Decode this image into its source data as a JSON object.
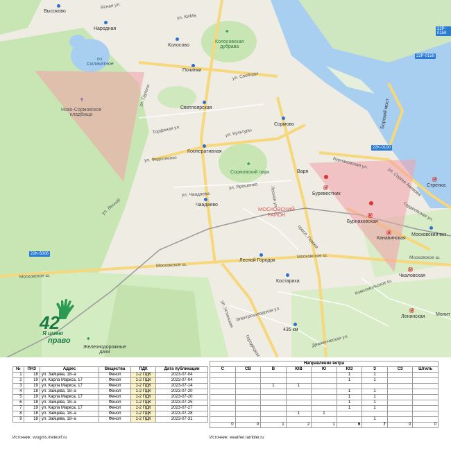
{
  "map": {
    "labels": {
      "vysokovo": "Высоково",
      "narodnaya": "Народная",
      "kolosovo": "Колосово",
      "kolosovskaya": "Колосовская\nдубрава",
      "silikatnoe": "оз.\nСиликатное",
      "pochinki": "Починки",
      "cemetery": "Ново-Сормовское\nкладбище",
      "svetloyarskaya": "Светлоярская",
      "sormovo": "Сормово",
      "kooperativnaya": "Кооперативная",
      "sormovsky_park": "Сормовский парк",
      "chaadaevo": "Чаадаево",
      "moskovsky_rayon": "МОСКОВСКИЙ\nРАЙОН",
      "lesnoy_gorodok": "Лесной Городок",
      "kostariha": "Костариха",
      "burevestnik": "Буревестник",
      "burnakovskaya": "Бурнаковская",
      "kanavinskaya": "Канавинская",
      "moskovsky_vkz": "Московский вкз.",
      "strelka": "Стрелка",
      "chkalovskaya": "Чкаловская",
      "leninskaya": "Ленинская",
      "molit": "Молит",
      "varya": "Варя",
      "zhd_dachi": "Железнодорожные\nдачи",
      "km435": "435 км",
      "borsky_most": "Борский мост"
    },
    "streets": {
      "kima": "ул. КИМа",
      "yasnaya": "Ясная ул.",
      "svobody": "ул. Свободы",
      "gaugelya": "ул. Гаугеля",
      "torfyanaya": "Торфяная ул.",
      "kultury": "ул. Культуры",
      "fedoseenko": "ул. Федосеенко",
      "yaroshenko": "ул. Ярошенко",
      "chaadaeva": "ул. Чаадаева",
      "moskovskoe1": "Московское ш.",
      "moskovskoe2": "Московское ш.",
      "moskovskoe3": "Московское ш.",
      "moskovskoe4": "Московское ш.",
      "geroev": "просп. Героев",
      "burnakovskaya_st": "Бурнаковская ул.",
      "sergeya_akimova": "ул. Сергея Акимова",
      "gordeevskaya": "Гордеевская ул.",
      "konsomolskaya": "Комсомольское ш.",
      "elektrozavodskaya": "Электрозаводская ул.",
      "gorodetskaya": "Городецкая ул.",
      "dvigatel": "Движенческая ул.",
      "lesnoy": "ул. Лесной",
      "ustinskaya": "ул. Устинская",
      "lesnaya": "Лесная ул."
    },
    "shields": {
      "r1": "22P-0159",
      "r2": "22P-0159",
      "r3": "22K-0100",
      "r4": "22K-5006"
    },
    "logo": {
      "number": "42",
      "line1": "Я имею",
      "line2": "право"
    }
  },
  "table_left": {
    "headers": [
      "№",
      "ПНЗ",
      "Адрес",
      "Вещества",
      "ПДК",
      "Дата публикации"
    ],
    "rows": [
      [
        "1",
        "18",
        "ул. Зайцева, 18–а",
        "Фенол",
        "1-2 ПДК",
        "2023-07-04"
      ],
      [
        "2",
        "19",
        "ул. Карла Маркса, 17",
        "Фенол",
        "1-2 ПДК",
        "2023-07-04"
      ],
      [
        "3",
        "19",
        "ул. Карла Маркса, 17",
        "Фенол",
        "1-2 ПДК",
        "2023-07-14"
      ],
      [
        "4",
        "18",
        "ул. Зайцева, 18–а",
        "Фенол",
        "1-2 ПДК",
        "2023-07-20"
      ],
      [
        "5",
        "19",
        "ул. Карла Маркса, 17",
        "Фенол",
        "1-2 ПДК",
        "2023-07-20"
      ],
      [
        "6",
        "18",
        "ул. Зайцева, 18–а",
        "Фенол",
        "1-2 ПДК",
        "2023-07-25"
      ],
      [
        "7",
        "19",
        "ул. Карла Маркса, 17",
        "Фенол",
        "1-2 ПДК",
        "2023-07-27"
      ],
      [
        "8",
        "18",
        "ул. Зайцева, 18–а",
        "Фенол",
        "1-2 ПДК",
        "2023-07-28"
      ],
      [
        "9",
        "18",
        "ул. Зайцева, 18–а",
        "Фенол",
        "1-2 ПДК",
        "2023-07-31"
      ]
    ],
    "source": "Источник: vvugms.meteorf.ru"
  },
  "table_right": {
    "title": "Направление ветра",
    "headers": [
      "С",
      "СВ",
      "В",
      "ЮВ",
      "Ю",
      "ЮЗ",
      "З",
      "СЗ",
      "Штиль"
    ],
    "rows": [
      [
        "",
        "",
        "",
        "",
        "",
        "1",
        "1",
        "",
        ""
      ],
      [
        "",
        "",
        "",
        "",
        "",
        "1",
        "1",
        "",
        ""
      ],
      [
        "",
        "",
        "1",
        "1",
        "",
        "",
        "",
        "",
        ""
      ],
      [
        "",
        "",
        "",
        "",
        "",
        "1",
        "1",
        "",
        ""
      ],
      [
        "",
        "",
        "",
        "",
        "",
        "1",
        "1",
        "",
        ""
      ],
      [
        "",
        "",
        "",
        "",
        "",
        "1",
        "1",
        "",
        ""
      ],
      [
        "",
        "",
        "",
        "",
        "",
        "1",
        "1",
        "",
        ""
      ],
      [
        "",
        "",
        "",
        "1",
        "1",
        "",
        "",
        "",
        ""
      ],
      [
        "",
        "",
        "",
        "",
        "",
        "",
        "1",
        "",
        ""
      ]
    ],
    "totals": [
      "0",
      "0",
      "1",
      "2",
      "1",
      "6",
      "7",
      "0",
      "0"
    ],
    "source": "Источник: weather.rambler.ru"
  },
  "colors": {
    "water": "#a9cff0",
    "forest": "#c8e6b4",
    "road": "#f7d77b",
    "zone": "#f2a0a8",
    "logo": "#1d7a45",
    "pdk_bg": "#fbf2c6"
  }
}
